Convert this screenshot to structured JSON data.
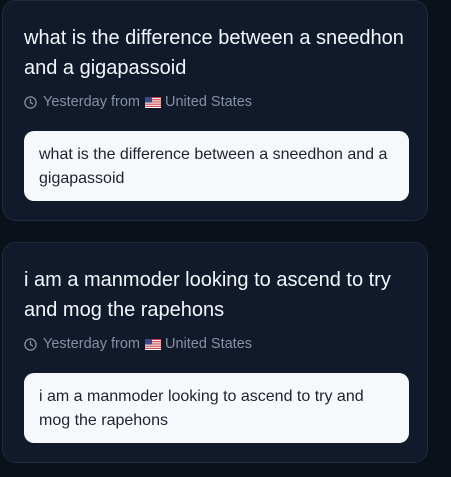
{
  "messages": [
    {
      "title": "what is the difference between a sneedhon and a gigapassoid",
      "time": "Yesterday",
      "from_label": "from",
      "location": "United States",
      "flag_icon": "us-flag-icon",
      "clock_icon": "clock-icon",
      "body": "what is the difference between a sneedhon and a gigapassoid"
    },
    {
      "title": "i am a manmoder looking to ascend to try and mog the rapehons",
      "time": "Yesterday",
      "from_label": "from",
      "location": "United States",
      "flag_icon": "us-flag-icon",
      "clock_icon": "clock-icon",
      "body": "i am a manmoder looking to ascend to try and mog the rapehons"
    }
  ],
  "colors": {
    "page_bg": "#0b111a",
    "card_bg": "#111a2a",
    "card_border": "#1f2a3b",
    "title_text": "#f3f6fb",
    "meta_text": "#8591a4",
    "bubble_bg": "#f6f8fb",
    "bubble_text": "#1b2330"
  }
}
